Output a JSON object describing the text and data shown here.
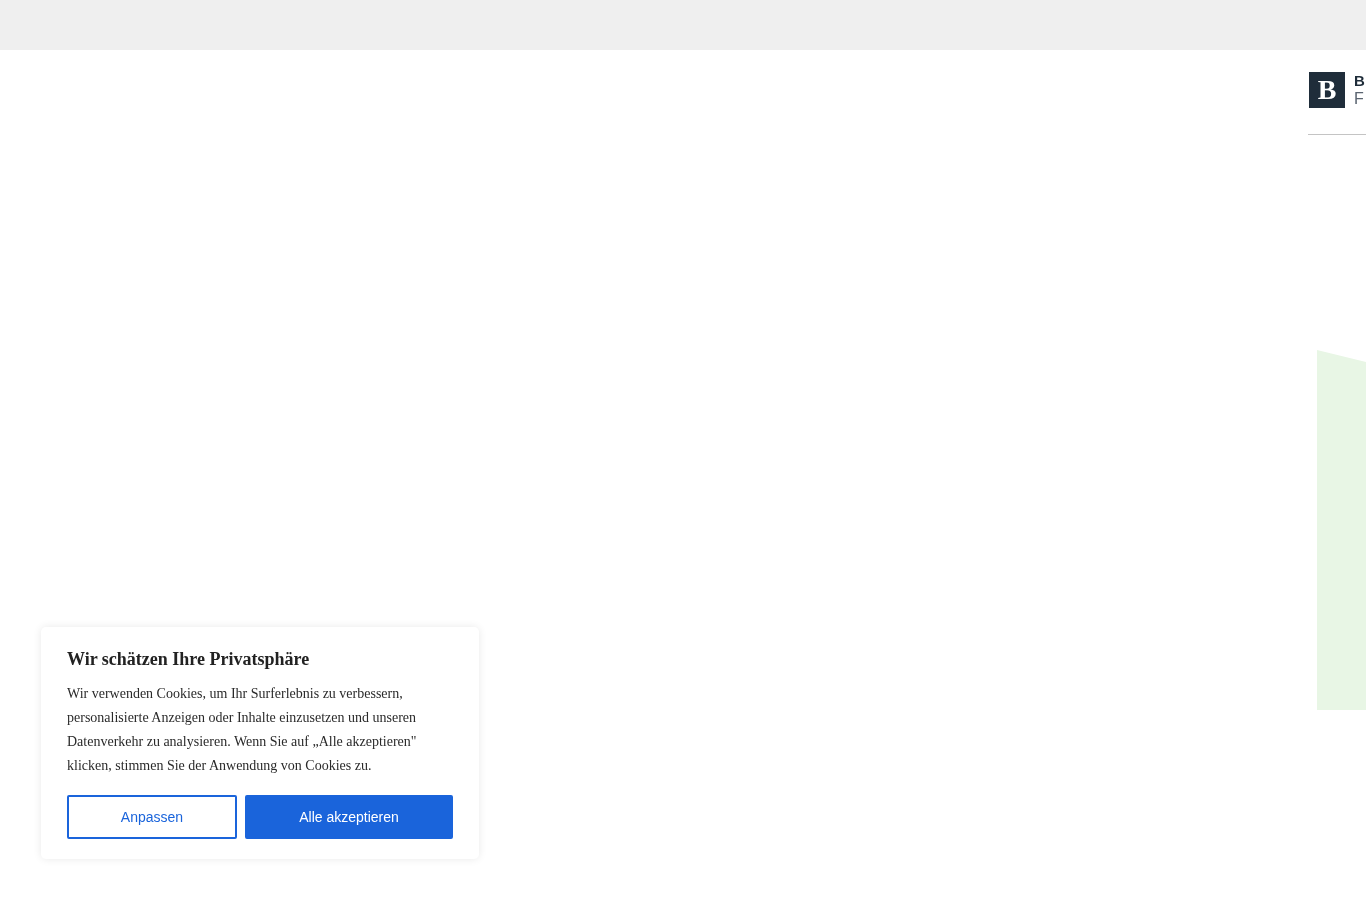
{
  "header": {
    "logo": {
      "mark": "B",
      "title": "B",
      "subtitle": "F"
    }
  },
  "cookie_banner": {
    "title": "Wir schätzen Ihre Privatsphäre",
    "text": "Wir verwenden Cookies, um Ihr Surferlebnis zu verbessern, personalisierte Anzeigen oder Inhalte einzusetzen und unseren Datenverkehr zu analysieren. Wenn Sie auf „Alle akzeptieren\" klicken, stimmen Sie der Anwendung von Cookies zu.",
    "buttons": [
      {
        "label": "Anpassen",
        "kind": "outline"
      },
      {
        "label": "Alle akzeptieren",
        "kind": "primary"
      }
    ]
  }
}
